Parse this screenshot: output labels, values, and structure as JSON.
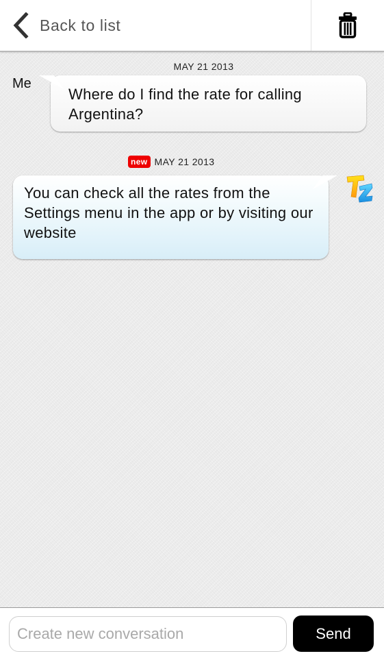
{
  "header": {
    "back_label": "Back to list",
    "back_icon": "chevron-left-icon",
    "delete_icon": "trash-icon"
  },
  "messages": [
    {
      "date": "MAY 21 2013",
      "sender_label": "Me",
      "text": "Where do I find the rate for calling Argentina?",
      "is_new": false
    },
    {
      "date": "MAY 21 2013",
      "badge": "new",
      "text": "You can check all the rates from the Settings menu in the app or by visiting our website",
      "sender_avatar": "tz-logo-icon",
      "is_new": true
    }
  ],
  "compose": {
    "placeholder": "Create new conversation",
    "value": "",
    "send_label": "Send"
  },
  "colors": {
    "badge_red": "#ee0000",
    "send_button": "#000000",
    "bubble_blue_bottom": "#d8eef8"
  }
}
